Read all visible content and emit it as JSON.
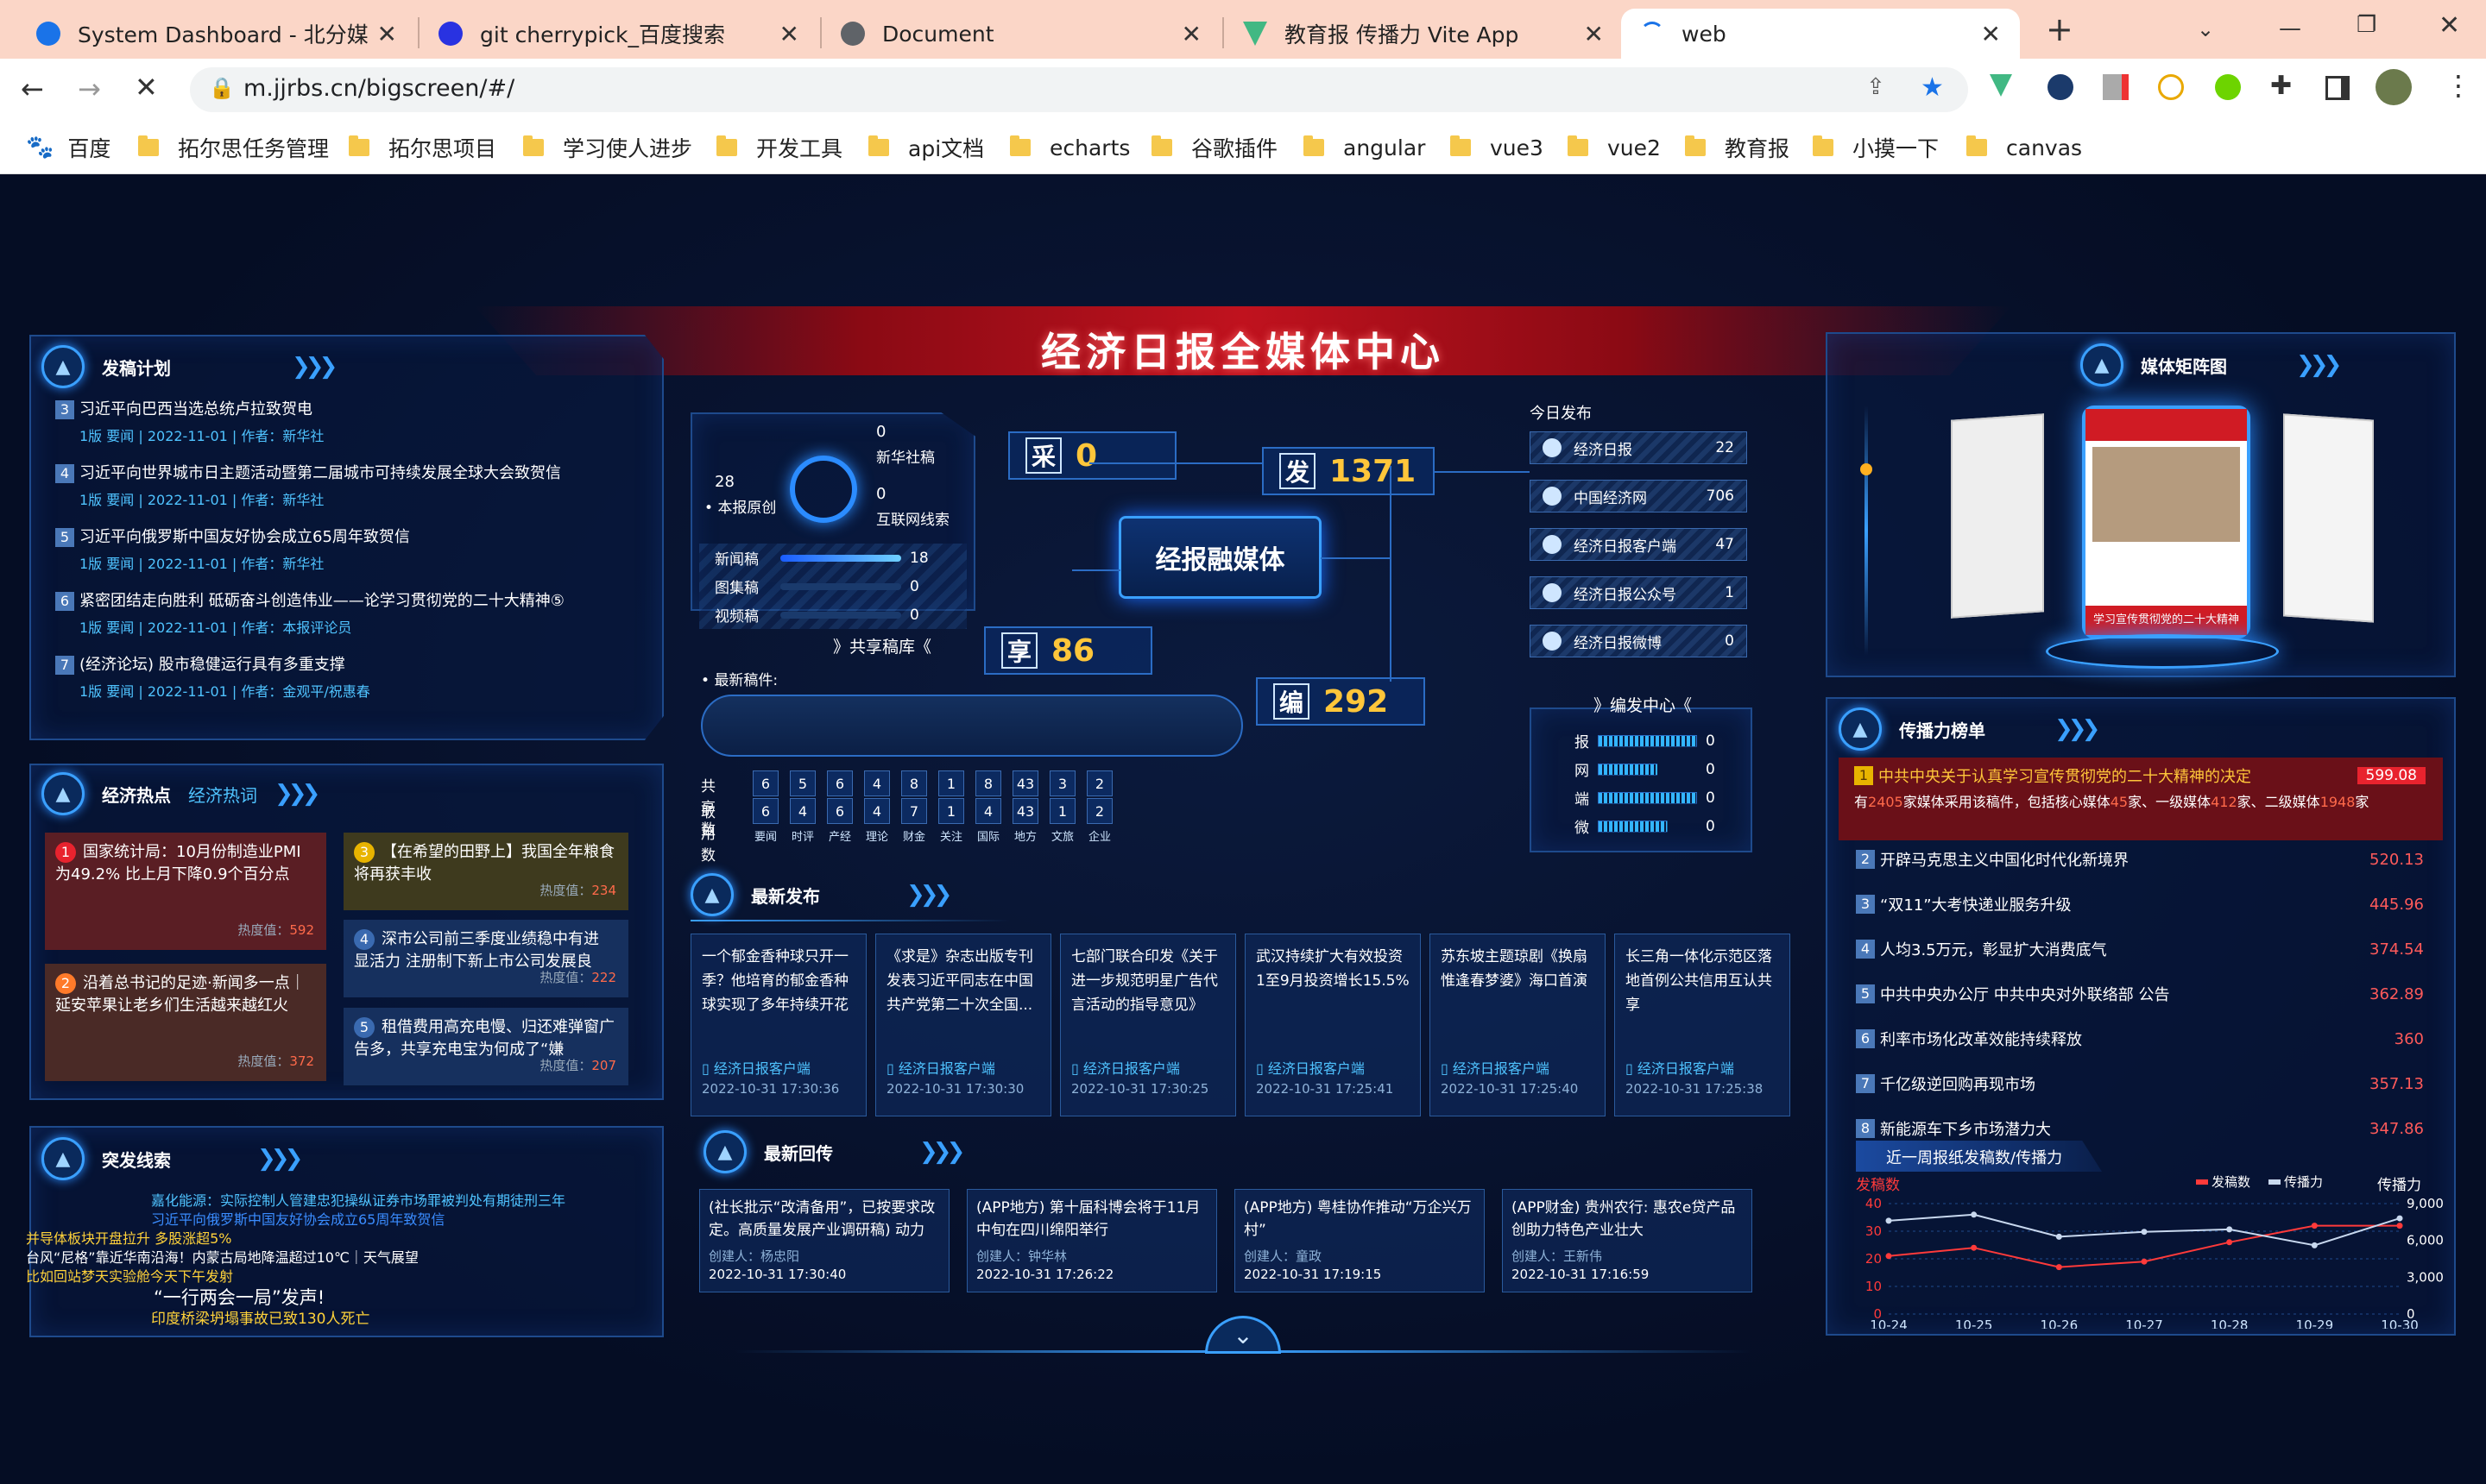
{
  "browser": {
    "tabs": [
      {
        "title": "System Dashboard - 北分媒体",
        "close": "✕"
      },
      {
        "title": "git cherrypick_百度搜索",
        "close": "✕"
      },
      {
        "title": "Document",
        "close": "✕"
      },
      {
        "title": "教育报 传播力 Vite App",
        "close": "✕"
      },
      {
        "title": "web",
        "close": "✕"
      }
    ],
    "new_tab": "+",
    "url": "m.jjrbs.cn/bigscreen/#/",
    "bookmarks": [
      "百度",
      "拓尔思任务管理",
      "拓尔思项目",
      "学习使人进步",
      "开发工具",
      "api文档",
      "echarts",
      "谷歌插件",
      "angular",
      "vue3",
      "vue2",
      "教育报",
      "小摸一下",
      "canvas"
    ]
  },
  "header": {
    "title": "经济日报全媒体中心"
  },
  "plan": {
    "title": "发稿计划",
    "items": [
      {
        "no": "3",
        "title": "习近平向巴西当选总统卢拉致贺电",
        "meta": "1版 要闻   |   2022-11-01   |   作者：新华社"
      },
      {
        "no": "4",
        "title": "习近平向世界城市日主题活动暨第二届城市可持续发展全球大会致贺信",
        "meta": "1版 要闻   |   2022-11-01   |   作者：新华社"
      },
      {
        "no": "5",
        "title": "习近平向俄罗斯中国友好协会成立65周年致贺信",
        "meta": "1版 要闻   |   2022-11-01   |   作者：新华社"
      },
      {
        "no": "6",
        "title": "紧密团结走向胜利 砥砺奋斗创造伟业——论学习贯彻党的二十大精神⑤",
        "meta": "1版 要闻   |   2022-11-01   |   作者：本报评论员"
      },
      {
        "no": "7",
        "title": "(经济论坛) 股市稳健运行具有多重支撑",
        "meta": "1版 要闻   |   2022-11-01   |   作者：金观平/祝惠春"
      }
    ]
  },
  "hot": {
    "title": "经济热点",
    "tab2": "经济热词",
    "items": [
      {
        "no": "1",
        "text": "国家统计局：10月份制造业PMI为49.2% 比上月下降0.9个百分点",
        "label": "热度值：",
        "value": "592"
      },
      {
        "no": "2",
        "text": "沿着总书记的足迹·新闻多一点｜延安苹果让老乡们生活越来越红火",
        "label": "热度值：",
        "value": "372"
      },
      {
        "no": "3",
        "text": "【在希望的田野上】我国全年粮食将再获丰收",
        "label": "热度值：",
        "value": "234"
      },
      {
        "no": "4",
        "text": "深市公司前三季度业绩稳中有进 显活力 注册制下新上市公司发展良",
        "label": "热度值：",
        "value": "222"
      },
      {
        "no": "5",
        "text": "租借费用高充电慢、归还难弹窗广告多，共享充电宝为何成了“嫌",
        "label": "热度值：",
        "value": "207"
      }
    ]
  },
  "clues": {
    "title": "突发线索",
    "lines": [
      "嘉化能源：实际控制人管建忠犯操纵证券市场罪被判处有期徒刑三年",
      "习近平向俄罗斯中国友好协会成立65周年致贺信",
      "并导体板块开盘拉升 多股涨超5%",
      "台风“尼格”靠近华南沿海！内蒙古局地降温超过10℃｜天气展望",
      "比如回站梦天实验舱今天下午发射",
      "“一行两会一局”发声!",
      "印度桥梁坍塌事故已致130人死亡"
    ]
  },
  "center": {
    "sources": [
      {
        "value": "0",
        "label": "新华社稿"
      },
      {
        "value": "28",
        "label": "本报原创"
      },
      {
        "value": "0",
        "label": "互联网线索"
      }
    ],
    "types": [
      {
        "label": "新闻稿",
        "value": "18"
      },
      {
        "label": "图集稿",
        "value": "0"
      },
      {
        "label": "视频稿",
        "value": "0"
      }
    ],
    "share_lib": "》共享稿库《",
    "latest_label": "最新稿件:",
    "stats": [
      {
        "key": "采",
        "value": "0"
      },
      {
        "key": "发",
        "value": "1371"
      },
      {
        "key": "享",
        "value": "86"
      },
      {
        "key": "编",
        "value": "292"
      }
    ],
    "core": "经报融媒体",
    "share_table": {
      "row1_label": "共享数",
      "row2_label": "取用数",
      "share": [
        "6",
        "5",
        "6",
        "4",
        "8",
        "1",
        "8",
        "43",
        "3",
        "2"
      ],
      "take": [
        "6",
        "4",
        "6",
        "4",
        "7",
        "1",
        "4",
        "43",
        "1",
        "2"
      ],
      "cats": [
        "要闻",
        "时评",
        "产经",
        "理论",
        "财金",
        "关注",
        "国际",
        "地方",
        "文旅",
        "企业"
      ]
    }
  },
  "today": {
    "title": "今日发布",
    "items": [
      {
        "label": "经济日报",
        "value": "22"
      },
      {
        "label": "中国经济网",
        "value": "706"
      },
      {
        "label": "经济日报客户端",
        "value": "47"
      },
      {
        "label": "经济日报公众号",
        "value": "1"
      },
      {
        "label": "经济日报微博",
        "value": "0"
      }
    ]
  },
  "editcenter": {
    "title": "》编发中心《",
    "items": [
      {
        "label": "报",
        "value": "0",
        "fill": 1.0
      },
      {
        "label": "网",
        "value": "0",
        "fill": 0.6
      },
      {
        "label": "端",
        "value": "0",
        "fill": 1.0
      },
      {
        "label": "微",
        "value": "0",
        "fill": 0.7
      }
    ]
  },
  "latest": {
    "title": "最新发布",
    "items": [
      {
        "text": "一个郁金香种球只开一季？他培育的郁金香种球实现了多年持续开花",
        "src": "经济日报客户端",
        "date": "2022-10-31 17:30:36"
      },
      {
        "text": "《求是》杂志出版专刊发表习近平同志在中国共产党第二十次全国...",
        "src": "经济日报客户端",
        "date": "2022-10-31 17:30:30"
      },
      {
        "text": "七部门联合印发《关于进一步规范明星广告代言活动的指导意见》",
        "src": "经济日报客户端",
        "date": "2022-10-31 17:30:25"
      },
      {
        "text": "武汉持续扩大有效投资 1至9月投资增长15.5%",
        "src": "经济日报客户端",
        "date": "2022-10-31 17:25:41"
      },
      {
        "text": "苏东坡主题琼剧《换扇惟逢春梦婆》海口首演",
        "src": "经济日报客户端",
        "date": "2022-10-31 17:25:40"
      },
      {
        "text": "长三角一体化示范区落地首例公共信用互认共享",
        "src": "经济日报客户端",
        "date": "2022-10-31 17:25:38"
      }
    ]
  },
  "replies": {
    "title": "最新回传",
    "items": [
      {
        "text": "(社长批示“改清备用”，已按要求改定。高质量发展产业调研稿) 动力",
        "creator": "创建人：杨忠阳",
        "date": "2022-10-31 17:30:40"
      },
      {
        "text": "(APP地方) 第十届科博会将于11月中旬在四川绵阳举行",
        "creator": "创建人：钟华林",
        "date": "2022-10-31 17:26:22"
      },
      {
        "text": "(APP地方) 粤桂协作推动“万企兴万村”",
        "creator": "创建人：童政",
        "date": "2022-10-31 17:19:15"
      },
      {
        "text": "(APP财金) 贵州农行: 惠农e贷产品创助力特色产业壮大",
        "creator": "创建人：王新伟",
        "date": "2022-10-31 17:16:59"
      }
    ]
  },
  "matrix": {
    "title": "媒体矩阵图",
    "phone_caption": "学习宣传贯彻党的二十大精神"
  },
  "rank": {
    "title": "传播力榜单",
    "top": {
      "no": "1",
      "title": "中共中央关于认真学习宣传贯彻党的二十大精神的决定",
      "value": "599.08",
      "desc_a": "有",
      "n1": "2405",
      "desc_b": "家媒体采用该稿件，包括核心媒体",
      "n2": "45",
      "desc_c": "家、一级媒体",
      "n3": "412",
      "desc_d": "家、二级媒体",
      "n4": "1948",
      "desc_e": "家"
    },
    "items": [
      {
        "no": "2",
        "title": "开辟马克思主义中国化时代化新境界",
        "value": "520.13"
      },
      {
        "no": "3",
        "title": "“双11”大考快递业服务升级",
        "value": "445.96"
      },
      {
        "no": "4",
        "title": "人均3.5万元，彰显扩大消费底气",
        "value": "374.54"
      },
      {
        "no": "5",
        "title": "中共中央办公厅 中共中央对外联络部 公告",
        "value": "362.89"
      },
      {
        "no": "6",
        "title": "利率市场化改革效能持续释放",
        "value": "360"
      },
      {
        "no": "7",
        "title": "千亿级逆回购再现市场",
        "value": "357.13"
      },
      {
        "no": "8",
        "title": "新能源车下乡市场潜力大",
        "value": "347.86"
      }
    ]
  },
  "chart_data": {
    "type": "line",
    "title": "近一周报纸发稿数/传播力",
    "x": [
      "10-24",
      "10-25",
      "10-26",
      "10-27",
      "10-28",
      "10-29",
      "10-30"
    ],
    "ylabel_left": "发稿数",
    "ylabel_right": "传播力",
    "y_left_ticks": [
      "40",
      "30",
      "20",
      "10",
      "0"
    ],
    "y_right_ticks": [
      "9,000",
      "6,000",
      "3,000",
      "0"
    ],
    "ylim_left": [
      0,
      40
    ],
    "ylim_right": [
      0,
      9000
    ],
    "legend_position": "top-right",
    "series": [
      {
        "name": "发稿数",
        "axis": "left",
        "color": "#ff3a3a",
        "values": [
          21,
          24,
          17,
          19,
          26,
          32,
          32
        ]
      },
      {
        "name": "传播力",
        "axis": "right",
        "color": "#c8d8ee",
        "values": [
          7600,
          8100,
          6300,
          6700,
          6900,
          5600,
          7800
        ]
      }
    ]
  }
}
